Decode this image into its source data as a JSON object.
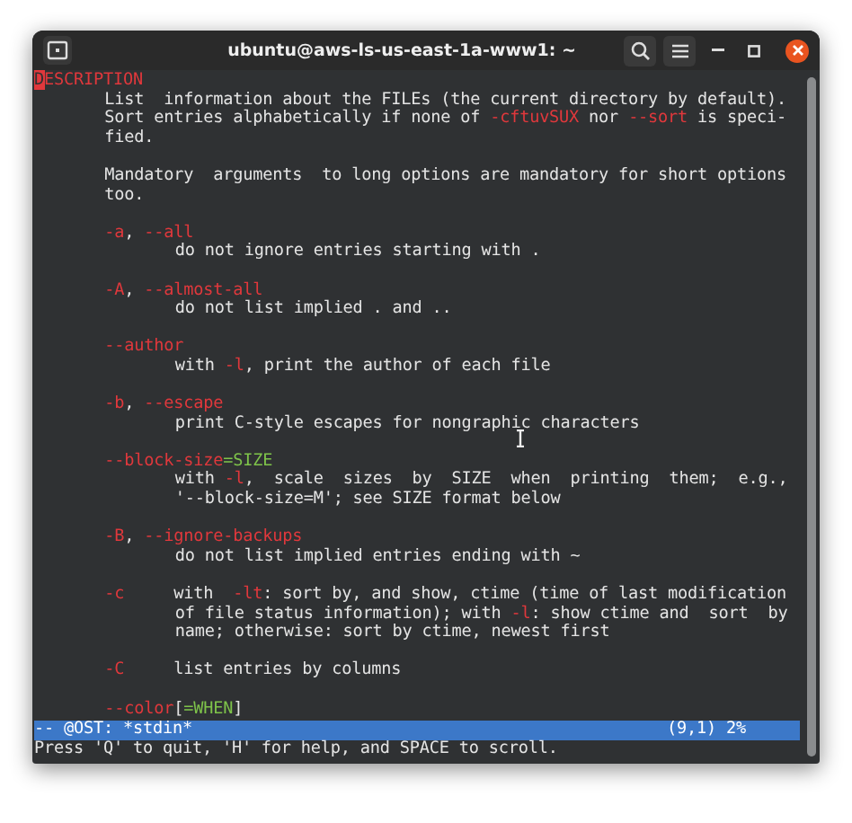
{
  "window": {
    "title": "ubuntu@aws-ls-us-east-1a-www1: ~"
  },
  "terminal": {
    "lines": [
      {
        "kind": "heading",
        "segments": [
          {
            "kind": "cursor",
            "text": "D"
          },
          {
            "kind": "option",
            "text": "ESCRIPTION"
          }
        ]
      },
      {
        "kind": "para",
        "segments": [
          {
            "kind": "text",
            "text": "List  information about the FILEs (the current directory by default)."
          }
        ]
      },
      {
        "kind": "para",
        "segments": [
          {
            "kind": "text",
            "text": "Sort entries alphabetically if none of "
          },
          {
            "kind": "option",
            "text": "-cftuvSUX"
          },
          {
            "kind": "text",
            "text": " nor "
          },
          {
            "kind": "option",
            "text": "--sort"
          },
          {
            "kind": "text",
            "text": " is speci-"
          }
        ]
      },
      {
        "kind": "para",
        "segments": [
          {
            "kind": "text",
            "text": "fied."
          }
        ]
      },
      {
        "kind": "blank"
      },
      {
        "kind": "para",
        "segments": [
          {
            "kind": "text",
            "text": "Mandatory  arguments  to long options are mandatory for short options"
          }
        ]
      },
      {
        "kind": "para",
        "segments": [
          {
            "kind": "text",
            "text": "too."
          }
        ]
      },
      {
        "kind": "blank"
      },
      {
        "kind": "para",
        "segments": [
          {
            "kind": "option",
            "text": "-a"
          },
          {
            "kind": "text",
            "text": ", "
          },
          {
            "kind": "option",
            "text": "--all"
          }
        ]
      },
      {
        "kind": "detail",
        "segments": [
          {
            "kind": "text",
            "text": "do not ignore entries starting with ."
          }
        ]
      },
      {
        "kind": "blank"
      },
      {
        "kind": "para",
        "segments": [
          {
            "kind": "option",
            "text": "-A"
          },
          {
            "kind": "text",
            "text": ", "
          },
          {
            "kind": "option",
            "text": "--almost-all"
          }
        ]
      },
      {
        "kind": "detail",
        "segments": [
          {
            "kind": "text",
            "text": "do not list implied . and .."
          }
        ]
      },
      {
        "kind": "blank"
      },
      {
        "kind": "para",
        "segments": [
          {
            "kind": "option",
            "text": "--author"
          }
        ]
      },
      {
        "kind": "detail",
        "segments": [
          {
            "kind": "text",
            "text": "with "
          },
          {
            "kind": "option",
            "text": "-l"
          },
          {
            "kind": "text",
            "text": ", print the author of each file"
          }
        ]
      },
      {
        "kind": "blank"
      },
      {
        "kind": "para",
        "segments": [
          {
            "kind": "option",
            "text": "-b"
          },
          {
            "kind": "text",
            "text": ", "
          },
          {
            "kind": "option",
            "text": "--escape"
          }
        ]
      },
      {
        "kind": "detail",
        "segments": [
          {
            "kind": "text",
            "text": "print C-style escapes for nongraphic characters"
          }
        ]
      },
      {
        "kind": "blank"
      },
      {
        "kind": "para",
        "segments": [
          {
            "kind": "option",
            "text": "--block-size"
          },
          {
            "kind": "arg",
            "text": "=SIZE"
          }
        ]
      },
      {
        "kind": "detail",
        "segments": [
          {
            "kind": "text",
            "text": "with "
          },
          {
            "kind": "option",
            "text": "-l"
          },
          {
            "kind": "text",
            "text": ",  scale  sizes  by  SIZE  when  printing  them;  e.g.,"
          }
        ]
      },
      {
        "kind": "detail",
        "segments": [
          {
            "kind": "text",
            "text": "'--block-size=M'; see SIZE format below"
          }
        ]
      },
      {
        "kind": "blank"
      },
      {
        "kind": "para",
        "segments": [
          {
            "kind": "option",
            "text": "-B"
          },
          {
            "kind": "text",
            "text": ", "
          },
          {
            "kind": "option",
            "text": "--ignore-backups"
          }
        ]
      },
      {
        "kind": "detail",
        "segments": [
          {
            "kind": "text",
            "text": "do not list implied entries ending with ~"
          }
        ]
      },
      {
        "kind": "blank"
      },
      {
        "kind": "para",
        "segments": [
          {
            "kind": "option",
            "text": "-c"
          },
          {
            "kind": "text",
            "text": "     with  "
          },
          {
            "kind": "option",
            "text": "-lt"
          },
          {
            "kind": "text",
            "text": ": sort by, and show, ctime (time of last modification"
          }
        ]
      },
      {
        "kind": "detail",
        "segments": [
          {
            "kind": "text",
            "text": "of file status information); with "
          },
          {
            "kind": "option",
            "text": "-l"
          },
          {
            "kind": "text",
            "text": ": show ctime and  sort  by"
          }
        ]
      },
      {
        "kind": "detail",
        "segments": [
          {
            "kind": "text",
            "text": "name; otherwise: sort by ctime, newest first"
          }
        ]
      },
      {
        "kind": "blank"
      },
      {
        "kind": "para",
        "segments": [
          {
            "kind": "option",
            "text": "-C"
          },
          {
            "kind": "text",
            "text": "     list entries by columns"
          }
        ]
      },
      {
        "kind": "blank"
      },
      {
        "kind": "para",
        "segments": [
          {
            "kind": "option",
            "text": "--color"
          },
          {
            "kind": "text",
            "text": "["
          },
          {
            "kind": "arg",
            "text": "=WHEN"
          },
          {
            "kind": "text",
            "text": "]"
          }
        ]
      }
    ],
    "status_bar": {
      "left": "-- @OST: *stdin*",
      "right": "(9,1) 2%"
    },
    "prompt": "Press 'Q' to quit, 'H' for help, and SPACE to scroll."
  }
}
